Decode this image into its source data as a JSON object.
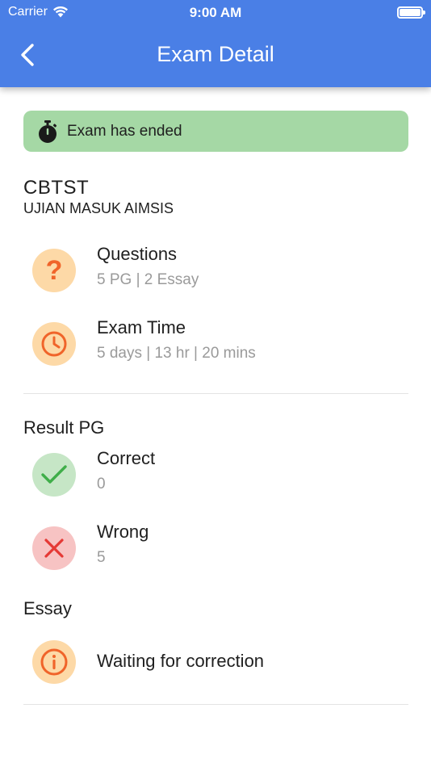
{
  "status_bar": {
    "carrier": "Carrier",
    "time": "9:00 AM"
  },
  "header": {
    "title": "Exam Detail"
  },
  "banner": {
    "text": "Exam has ended"
  },
  "exam": {
    "code": "CBTST",
    "name": "UJIAN MASUK AIMSIS"
  },
  "info": {
    "questions": {
      "title": "Questions",
      "detail": "5 PG | 2 Essay"
    },
    "exam_time": {
      "title": "Exam Time",
      "detail": "5 days | 13 hr | 20 mins"
    }
  },
  "result_pg": {
    "heading": "Result PG",
    "correct": {
      "title": "Correct",
      "value": "0"
    },
    "wrong": {
      "title": "Wrong",
      "value": "5"
    }
  },
  "essay": {
    "heading": "Essay",
    "status": "Waiting for correction"
  },
  "colors": {
    "primary": "#4a7fe6",
    "banner": "#a5d8a5",
    "orange_icon": "#f0642a",
    "green_icon": "#3fae49",
    "red_icon": "#e53935"
  },
  "icons": {
    "back": "chevron-left-icon",
    "banner": "stopwatch-icon",
    "questions": "question-mark-icon",
    "exam_time": "clock-icon",
    "correct": "check-icon",
    "wrong": "close-icon",
    "essay": "info-icon"
  }
}
